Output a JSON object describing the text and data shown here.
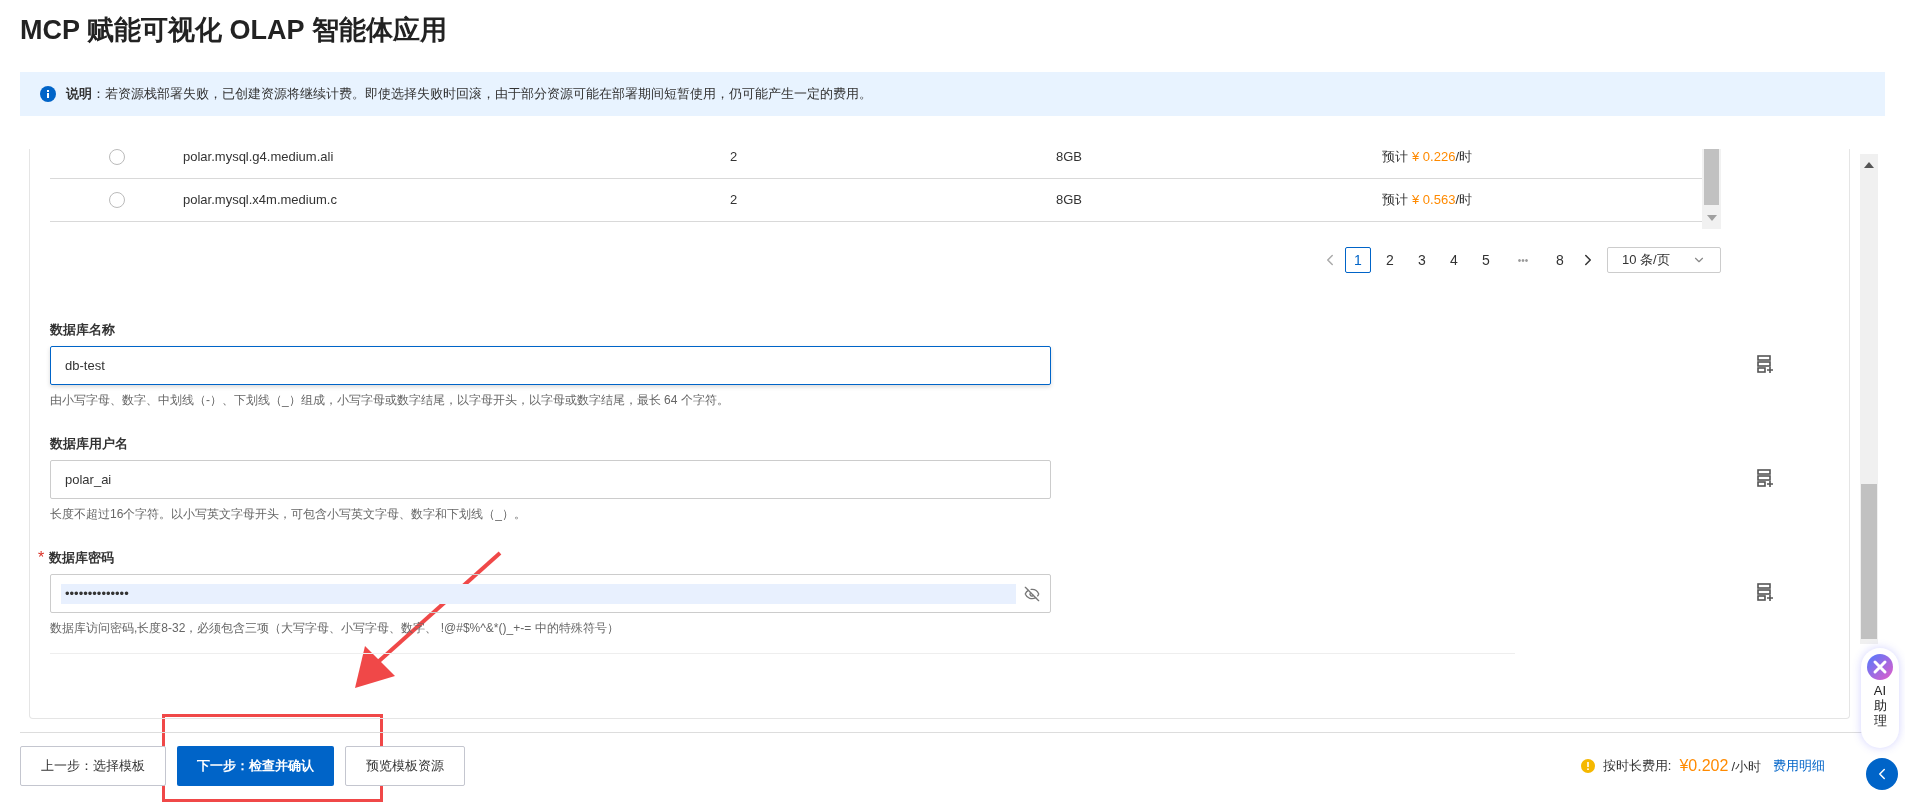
{
  "page_title": "MCP 赋能可视化 OLAP 智能体应用",
  "notice": {
    "text": "**说明**：若资源栈部署失败，已创建资源将继续计费。即使选择失败时回滚，由于部分资源可能在部署期间短暂使用，仍可能产生一定的费用。"
  },
  "instance_table": {
    "rows": [
      {
        "selected": false,
        "spec": "polar.mysql.g4.medium.ali",
        "cpu": "2",
        "memory": "8GB",
        "price_prefix": "预计",
        "price": "¥ 0.226",
        "price_suffix": "/时"
      },
      {
        "selected": false,
        "spec": "polar.mysql.x4m.medium.c",
        "cpu": "2",
        "memory": "8GB",
        "price_prefix": "预计",
        "price": "¥ 0.563",
        "price_suffix": "/时"
      }
    ]
  },
  "pagination": {
    "page_size": "10 条/页",
    "pages": [
      {
        "label": "1",
        "kind": "page",
        "selected": true
      },
      {
        "label": "2",
        "kind": "page",
        "selected": false
      },
      {
        "label": "3",
        "kind": "page",
        "selected": false
      },
      {
        "label": "4",
        "kind": "page",
        "selected": false
      },
      {
        "label": "5",
        "kind": "page",
        "selected": false
      },
      {
        "label": "•••",
        "kind": "ellipsis"
      },
      {
        "label": "8",
        "kind": "page",
        "selected": false
      }
    ]
  },
  "fields": [
    {
      "label": "数据库名称",
      "kind": "text",
      "focused": true,
      "value": "db-test",
      "help": "由小写字母、数字、中划线（-）、下划线（_）组成，小写字母或数字结尾，以字母开头，以字母或数字结尾，最长 64 个字符。"
    },
    {
      "label": "数据库用户名",
      "kind": "text",
      "focused": false,
      "value": "polar_ai",
      "help": "长度不超过16个字符。以小写英文字母开头，可包含小写英文字母、数字和下划线（_）。"
    },
    {
      "label": "数据库密码",
      "required_mark": "*",
      "kind": "password",
      "focused": false,
      "value": "••••••••••••••",
      "help": "数据库访问密码,长度8-32，必须包含三项（大写字母、小写字母、数字、 !@#$%^&*()_+-= 中的特殊符号）"
    }
  ],
  "buttons": [
    {
      "label": "上一步：选择模板",
      "kind": "default"
    },
    {
      "label": "下一步：检查并确认",
      "kind": "primary"
    },
    {
      "label": "预览模板资源",
      "kind": "default"
    }
  ],
  "cost": {
    "label": "按时长费用:",
    "amount": "¥0.202",
    "unit": "/小时",
    "link": "费用明细"
  },
  "assistant": {
    "label": "AI助理"
  }
}
